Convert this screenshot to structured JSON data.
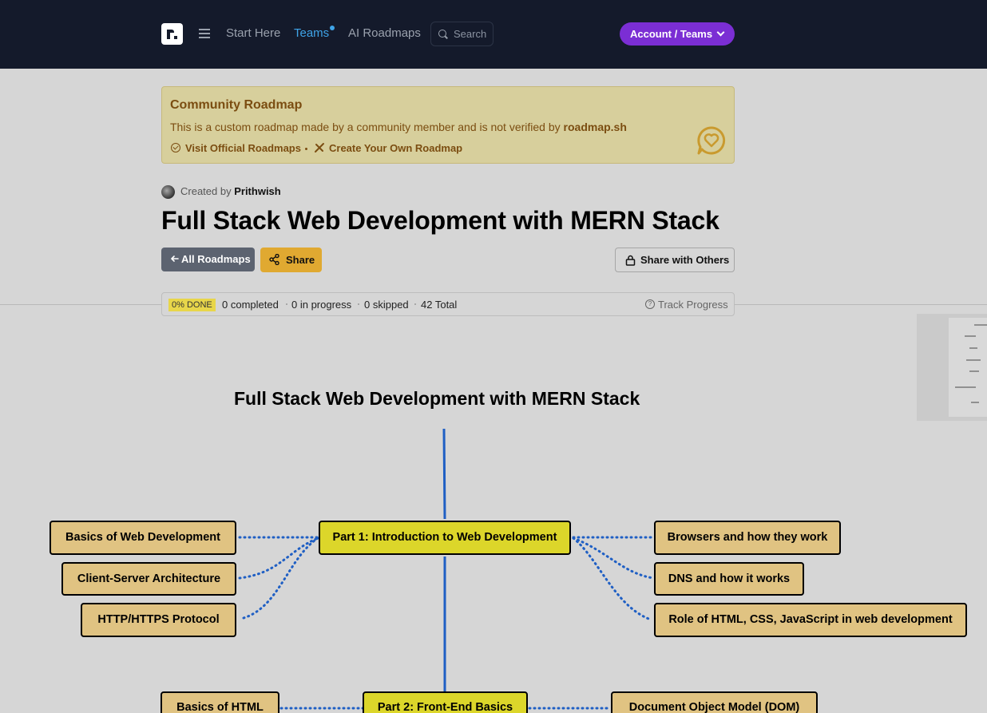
{
  "header": {
    "nav": {
      "start_here": "Start Here",
      "teams": "Teams",
      "ai_roadmaps": "AI Roadmaps"
    },
    "search_label": "Search",
    "account_button": "Account / Teams"
  },
  "banner": {
    "title": "Community Roadmap",
    "text_prefix": "This is a custom roadmap made by a community member and is not verified by",
    "text_brand": "roadmap.sh",
    "visit_official": "Visit Official Roadmaps",
    "create_own": "Create Your Own Roadmap"
  },
  "author": {
    "created_by": "Created by",
    "name": "Prithwish"
  },
  "page_title": "Full Stack Web Development with MERN Stack",
  "actions": {
    "all_roadmaps": "All Roadmaps",
    "share": "Share",
    "share_with_others": "Share with Others"
  },
  "progress": {
    "done_badge": "0% DONE",
    "completed": "0 completed",
    "in_progress": "0 in progress",
    "skipped": "0 skipped",
    "total": "42 Total",
    "track": "Track Progress"
  },
  "roadmap": {
    "title": "Full Stack Web Development with MERN Stack",
    "nodes": {
      "part1": "Part 1: Introduction to Web Development",
      "basics_web": "Basics of Web Development",
      "client_server": "Client-Server Architecture",
      "http": "HTTP/HTTPS Protocol",
      "browsers": "Browsers and how they work",
      "dns": "DNS and how it works",
      "role_html": "Role of HTML, CSS, JavaScript in web development",
      "part2": "Part 2: Front-End Basics",
      "basics_html": "Basics of HTML",
      "dom": "Document Object Model (DOM)"
    }
  },
  "colors": {
    "topbar": "#141a2b",
    "accent_purple": "#7b2ed4",
    "topic_node": "#e0c382",
    "main_node": "#dcd62a",
    "connector": "#1f5fc4"
  }
}
